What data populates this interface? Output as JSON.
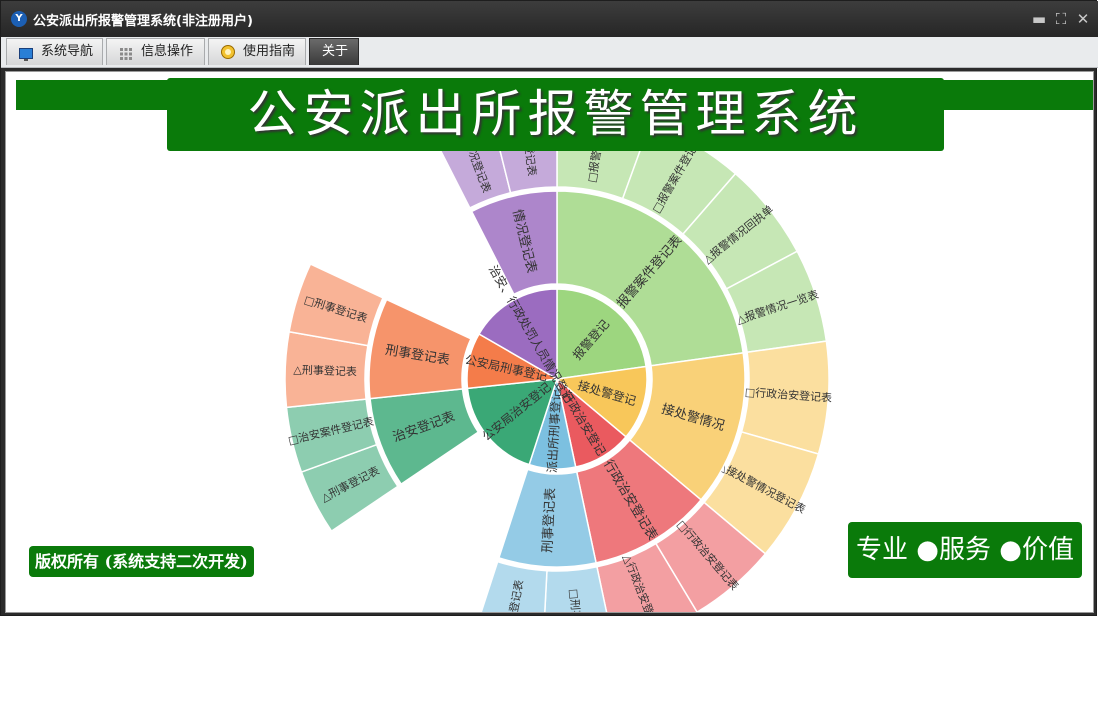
{
  "window": {
    "title": "公安派出所报警管理系统(非注册用户)",
    "logo_text": "Y",
    "controls": {
      "minimize": "▬",
      "restore": "⛶",
      "close": "✕"
    }
  },
  "tabs": [
    {
      "label": "系统导航",
      "icon": "monitor-icon",
      "active": false
    },
    {
      "label": "信息操作",
      "icon": "grid-icon",
      "active": false
    },
    {
      "label": "使用指南",
      "icon": "help-icon",
      "active": false
    },
    {
      "label": "关于",
      "icon": "",
      "active": true
    }
  ],
  "banner": {
    "title": "公安派出所报警管理系统"
  },
  "copyright": "版权所有 (系统支持二次开发)",
  "slogan": "专业 ●服务 ●价值",
  "colors": {
    "titlebar": "#2b2b2b",
    "brand_green": "#0a7a0a",
    "active_tab": "#4a4a4a"
  },
  "chart_data": {
    "type": "sunburst",
    "center": "",
    "rings": [
      {
        "level": 1,
        "label": "报警登记",
        "color": "#9dd67f"
      },
      {
        "level": 1,
        "label": "接处警登记",
        "color": "#f8c75a"
      },
      {
        "level": 1,
        "label": "行政治安登记",
        "color": "#ea5a5f"
      },
      {
        "level": 1,
        "label": "派出所刑事登记",
        "color": "#7cc0e0"
      },
      {
        "level": 1,
        "label": "公安局治安登记",
        "color": "#3aa876"
      },
      {
        "level": 1,
        "label": "公安局刑事登记",
        "color": "#f47c4a"
      },
      {
        "level": 1,
        "label": "治安、行政处罚人员情况登记",
        "color": "#9b6cc0"
      },
      {
        "level": 2,
        "label": "报警案件登记表"
      },
      {
        "level": 2,
        "label": "接处警情况"
      },
      {
        "level": 2,
        "label": "行政治安登记表"
      },
      {
        "level": 2,
        "label": "刑事登记表"
      },
      {
        "level": 2,
        "label": "治安登记表"
      },
      {
        "level": 2,
        "label": "刑事登记表"
      },
      {
        "level": 2,
        "label": "情况登记表"
      },
      {
        "level": 3,
        "label": "□报警案件..."
      },
      {
        "level": 3,
        "label": "□报警案件登记"
      },
      {
        "level": 3,
        "label": "△报警情况回执单"
      },
      {
        "level": 3,
        "label": "△报警情况一览表"
      },
      {
        "level": 3,
        "label": "□行政治安登记表"
      },
      {
        "level": 3,
        "label": "△接处警情况登记表"
      },
      {
        "level": 3,
        "label": "□行政治安登记表"
      },
      {
        "level": 3,
        "label": "△行政治安登记表"
      },
      {
        "level": 3,
        "label": "□刑事..."
      },
      {
        "level": 3,
        "label": "刑事登记表"
      },
      {
        "level": 3,
        "label": "△刑事登记表"
      },
      {
        "level": 3,
        "label": "□治安案件登记表"
      },
      {
        "level": 3,
        "label": "△刑事登记表"
      },
      {
        "level": 3,
        "label": "□刑事登记表"
      },
      {
        "level": 3,
        "label": "□情况登记表"
      },
      {
        "level": 3,
        "label": "情况登记表"
      }
    ]
  }
}
